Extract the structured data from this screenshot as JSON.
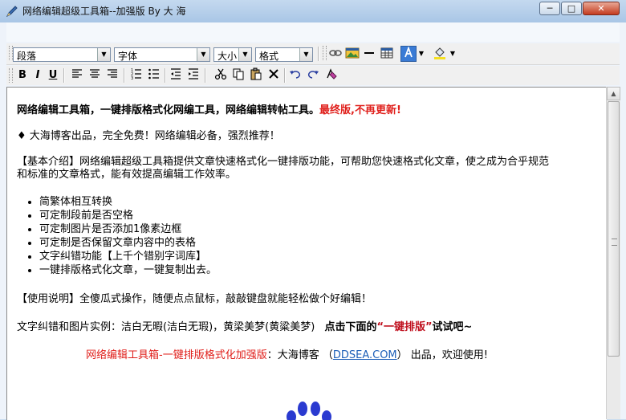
{
  "window": {
    "title": "网络编辑超级工具箱--加强版 By 大 海",
    "minimize_label": "─",
    "maximize_label": "□",
    "close_label": "✕"
  },
  "toolbar": {
    "paragraph_select": "段落",
    "font_select": "字体",
    "size_select": "大小",
    "format_select": "格式",
    "bold": "B",
    "italic": "I",
    "underline": "U"
  },
  "content": {
    "headline_black": "网络编辑工具箱，一键排版格式化网编工具，网络编辑转帖工具。",
    "headline_red": "最终版,不再更新!",
    "intro_line": "♦ 大海博客出品，完全免费！网络编辑必备，强烈推荐！",
    "basic_intro_1": "【基本介绍】网络编辑超级工具箱提供文章快速格式化一键排版功能，可帮助您快速格式化文章，使之成为合乎规范",
    "basic_intro_2": "和标准的文章格式，能有效提高编辑工作效率。",
    "features": [
      "简繁体相互转换",
      "可定制段前是否空格",
      "可定制图片是否添加1像素边框",
      "可定制是否保留文章内容中的表格",
      "文字纠错功能【上千个错别字词库】",
      "一键排版格式化文章，一键复制出去。"
    ],
    "usage": "【使用说明】全傻瓜式操作，随便点点鼠标，敲敲键盘就能轻松做个好编辑！",
    "example_prefix": "文字纠错和图片实例：洁白无暇(洁白无瑕)，黄梁美梦(黄粱美梦)",
    "example_bold": "点击下面的",
    "example_red": "“一键排版”",
    "example_suffix": "试试吧~",
    "footer_red": "网络编辑工具箱-一键排版格式化加强版",
    "footer_mid": "：大海博客 （",
    "footer_link": "DDSEA.COM",
    "footer_end": "） 出品，欢迎使用!"
  }
}
